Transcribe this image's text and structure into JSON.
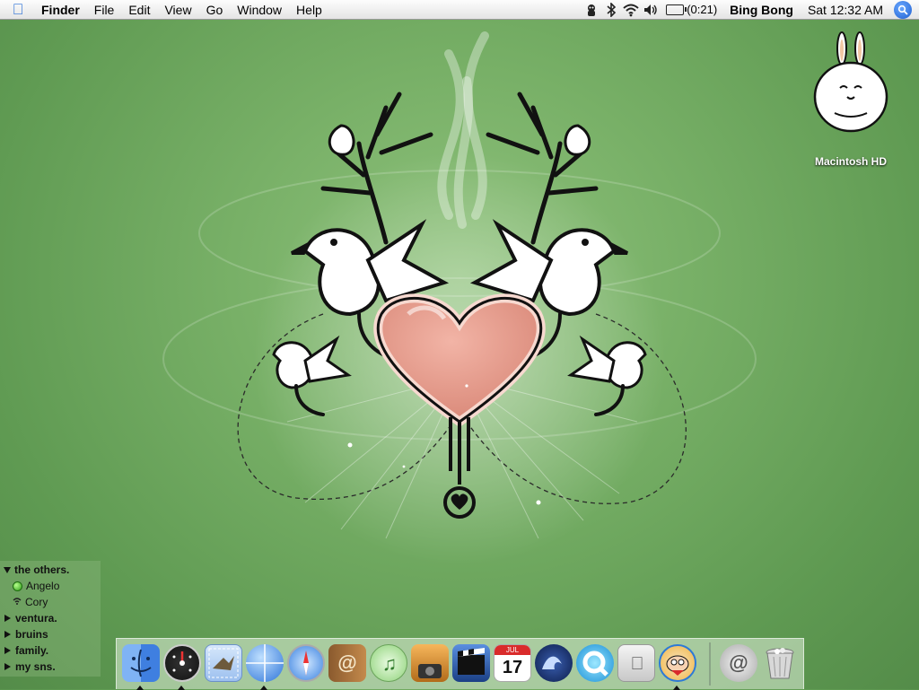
{
  "menubar": {
    "apple_icon": "apple-icon",
    "app_name": "Finder",
    "menus": [
      "File",
      "Edit",
      "View",
      "Go",
      "Window",
      "Help"
    ],
    "battery_time": "(0:21)",
    "user_name": "Bing Bong",
    "clock": "Sat 12:32 AM"
  },
  "desktop": {
    "volume_label": "Macintosh HD"
  },
  "buddy_list": {
    "groups": [
      {
        "name": "the others.",
        "expanded": true
      },
      {
        "name": "ventura.",
        "expanded": false
      },
      {
        "name": "bruins",
        "expanded": false
      },
      {
        "name": "family.",
        "expanded": false
      },
      {
        "name": "my sns.",
        "expanded": false
      }
    ],
    "members": [
      {
        "name": "Angelo",
        "status": "available"
      },
      {
        "name": "Cory",
        "status": "wireless"
      }
    ]
  },
  "dock": {
    "calendar_day": "17",
    "calendar_month": "JUL",
    "apps": [
      "finder-icon",
      "dashboard-icon",
      "mail-icon",
      "network-icon",
      "safari-icon",
      "address-book-icon",
      "itunes-icon",
      "iphoto-icon",
      "imovie-icon",
      "ical-icon",
      "wave-app-icon",
      "quicktime-icon",
      "preview-icon",
      "family-guy-icon",
      "mail-server-icon",
      "trash-icon"
    ]
  },
  "colors": {
    "wallpaper": "#78b067",
    "heart": "#e49a8c",
    "menubar": "#f2f2f2"
  }
}
